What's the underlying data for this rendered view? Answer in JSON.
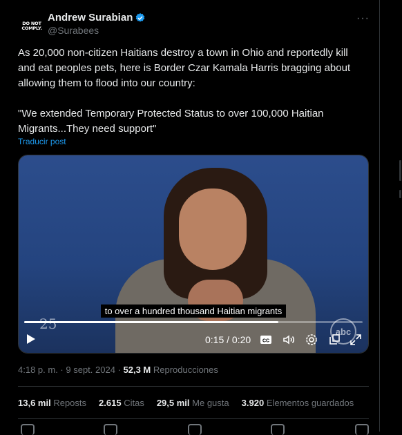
{
  "author": {
    "name": "Andrew Surabian",
    "handle": "@Surabees",
    "avatar_text": [
      "DO NOT",
      "COMPLY."
    ],
    "verified": true,
    "verified_color": "#1d9bf0"
  },
  "tweet": {
    "text": "As 20,000 non-citizen Haitians destroy a town in Ohio and reportedly kill and eat peoples pets, here is Border Czar Kamala Harris bragging about allowing them to flood into our country:\n\n\"We extended Temporary Protected Status to over 100,000 Haitian Migrants...They need support\"",
    "translate_label": "Traducir post"
  },
  "video": {
    "caption": "to over a hundred thousand Haitian migrants",
    "time": "0:15 / 0:20",
    "progress_fraction": 0.75,
    "stamp": "25",
    "logo": "abc",
    "controls": [
      "play-icon",
      "captions-icon",
      "volume-icon",
      "settings-icon",
      "popout-icon",
      "fullscreen-icon"
    ]
  },
  "meta": {
    "time": "4:18 p. m.",
    "date": "9 sept. 2024",
    "views": "52,3 M",
    "views_label": "Reproducciones"
  },
  "stats": [
    {
      "value": "13,6 mil",
      "label": "Reposts"
    },
    {
      "value": "2.615",
      "label": "Citas"
    },
    {
      "value": "29,5 mil",
      "label": "Me gusta"
    },
    {
      "value": "3.920",
      "label": "Elementos guardados"
    }
  ],
  "colors": {
    "background": "#000000",
    "text": "#e7e9ea",
    "muted": "#71767b",
    "accent": "#1d9bf0",
    "divider": "#2f3336"
  }
}
